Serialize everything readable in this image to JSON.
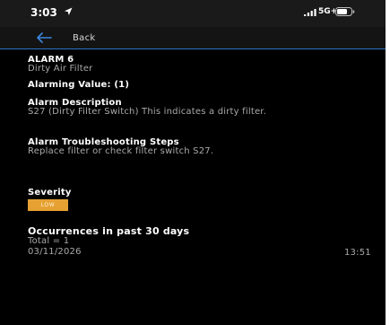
{
  "status_bar": {
    "time": "3:03",
    "network": "5G+"
  },
  "nav": {
    "back_label": "Back"
  },
  "alarm": {
    "title": "ALARM 6",
    "name": "Dirty Air Filter",
    "alarming_value": "Alarming Value: (1)",
    "description_label": "Alarm Description",
    "description_text": "S27 (Dirty Filter Switch) This indicates a dirty filter.",
    "troubleshooting_label": "Alarm Troubleshooting Steps",
    "troubleshooting_text": "Replace filter or check filter switch S27.",
    "severity_label": "Severity",
    "severity_value": "LOW",
    "occurrences_label": "Occurrences in past 30 days",
    "occurrences_total": "Total = 1",
    "occurrences": [
      {
        "date": "03/11/2026",
        "time": "13:51"
      }
    ]
  },
  "colors": {
    "accent": "#2f74c9",
    "severity_low": "#e6a133",
    "background": "#000000"
  },
  "icons": {
    "location": "location-arrow-icon",
    "signal": "cellular-signal-icon",
    "battery": "battery-icon",
    "back": "back-arrow-icon"
  }
}
